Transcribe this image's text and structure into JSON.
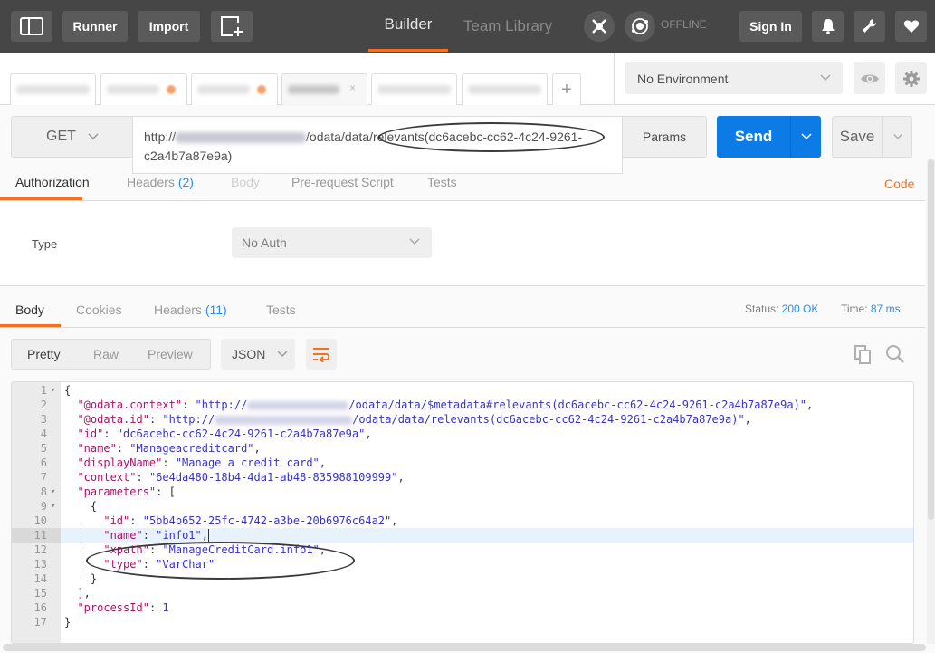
{
  "topbar": {
    "runner_label": "Runner",
    "import_label": "Import",
    "builder_tab": "Builder",
    "team_library_tab": "Team Library",
    "offline_label": "OFFLINE",
    "sign_in_label": "Sign In"
  },
  "request_tabs": {
    "tabs": [
      {
        "label": "(blurred)",
        "unsaved": false,
        "active": false
      },
      {
        "label": "(blurred)",
        "unsaved": true,
        "active": false
      },
      {
        "label": "(blurred)",
        "unsaved": true,
        "active": false
      },
      {
        "label": "(blurred)",
        "unsaved": false,
        "active": true
      },
      {
        "label": "(blurred)",
        "unsaved": false,
        "active": false
      },
      {
        "label": "(blurred)",
        "unsaved": false,
        "active": false
      }
    ],
    "add_label": "+"
  },
  "environment": {
    "selected": "No Environment"
  },
  "request": {
    "method": "GET",
    "url_prefix": "http://",
    "url_path": "/odata/data/",
    "url_highlight": "relevants(dc6acebc-cc62-4c24-9261-c2a4b7a87e9a)",
    "params_label": "Params",
    "send_label": "Send",
    "save_label": "Save"
  },
  "request_subtabs": {
    "authorization": "Authorization",
    "headers": "Headers",
    "headers_count": "(2)",
    "body": "Body",
    "prerequest": "Pre-request Script",
    "tests": "Tests",
    "code_link": "Code"
  },
  "auth": {
    "type_label": "Type",
    "type_value": "No Auth"
  },
  "response": {
    "tabs": {
      "body": "Body",
      "cookies": "Cookies",
      "headers": "Headers",
      "headers_count": "(11)",
      "tests": "Tests"
    },
    "status_label": "Status:",
    "status_value": "200 OK",
    "time_label": "Time:",
    "time_value": "87 ms",
    "view_modes": [
      "Pretty",
      "Raw",
      "Preview"
    ],
    "active_view": "Pretty",
    "format": "JSON"
  },
  "code_lines": [
    {
      "n": "1",
      "fold": true
    },
    {
      "n": "2"
    },
    {
      "n": "3"
    },
    {
      "n": "4"
    },
    {
      "n": "5"
    },
    {
      "n": "6"
    },
    {
      "n": "7"
    },
    {
      "n": "8",
      "fold": true
    },
    {
      "n": "9",
      "fold": true
    },
    {
      "n": "10"
    },
    {
      "n": "11"
    },
    {
      "n": "12"
    },
    {
      "n": "13"
    },
    {
      "n": "14"
    },
    {
      "n": "15"
    },
    {
      "n": "16"
    },
    {
      "n": "17"
    }
  ],
  "json_body": {
    "open": "{",
    "context_key": "\"@odata.context\"",
    "context_prefix": "\"http://",
    "context_suffix": "/odata/data/$metadata#relevants(dc6acebc-cc62-4c24-9261-c2a4b7a87e9a)\"",
    "id_url_key": "\"@odata.id\"",
    "id_url_prefix": "\"http://",
    "id_url_suffix": "/odata/data/relevants(dc6acebc-cc62-4c24-9261-c2a4b7a87e9a)\"",
    "id_key": "\"id\"",
    "id_value": "\"dc6acebc-cc62-4c24-9261-c2a4b7a87e9a\"",
    "name_key": "\"name\"",
    "name_value": "\"Manageacreditcard\"",
    "display_key": "\"displayName\"",
    "display_value": "\"Manage a credit card\"",
    "ctx_key": "\"context\"",
    "ctx_value": "\"6e4da480-18b4-4da1-ab48-835988109999\"",
    "params_key": "\"parameters\"",
    "arr_open": "[",
    "obj_open": "{",
    "p_id_key": "\"id\"",
    "p_id_value": "\"5bb4b652-25fc-4742-a3be-20b6976c64a2\"",
    "p_name_key": "\"name\"",
    "p_name_value": "\"info1\"",
    "p_xpath_key": "\"xpath\"",
    "p_xpath_value": "\"ManageCreditCard.info1\"",
    "p_type_key": "\"type\"",
    "p_type_value": "\"VarChar\"",
    "obj_close": "}",
    "arr_close": "],",
    "process_key": "\"processId\"",
    "process_value": "1",
    "close": "}"
  }
}
